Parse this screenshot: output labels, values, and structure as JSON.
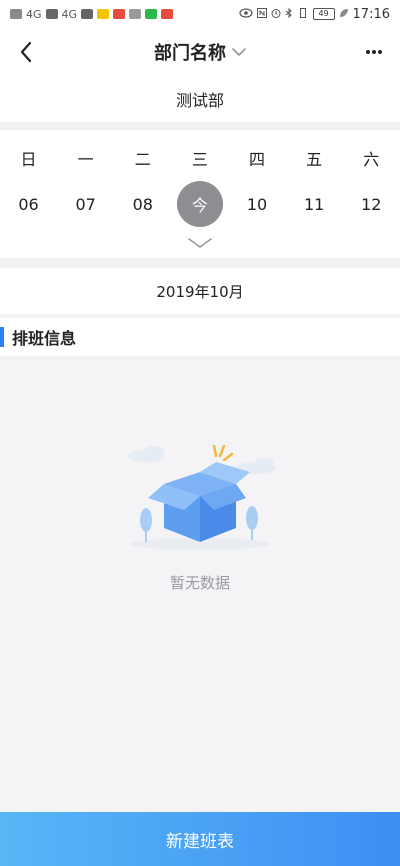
{
  "status_bar": {
    "time": "17:16",
    "battery": "49",
    "network_a": "4G",
    "network_b": "4G",
    "accent_colors": [
      "#f5c400",
      "#e84a3a",
      "#2db84a",
      "#e84a3a"
    ]
  },
  "nav": {
    "title": "部门名称",
    "back_icon": "chevron-left-icon",
    "dropdown_icon": "chevron-down-icon",
    "more_icon": "more-dots-icon"
  },
  "department": {
    "name": "测试部"
  },
  "calendar": {
    "weekdays": [
      "日",
      "一",
      "二",
      "三",
      "四",
      "五",
      "六"
    ],
    "dates": [
      "06",
      "07",
      "08",
      "今",
      "10",
      "11",
      "12"
    ],
    "selected_index": 3,
    "selected_color": "#8e8e92",
    "expand_icon": "chevron-down-icon"
  },
  "month": {
    "label": "2019年10月"
  },
  "schedule": {
    "section_title": "排班信息",
    "accent_color": "#2f7ff5",
    "empty_text": "暂无数据",
    "empty_icon": "empty-box-icon"
  },
  "footer": {
    "new_button_label": "新建班表",
    "gradient": [
      "#58b6f6",
      "#3d8ff3"
    ]
  }
}
